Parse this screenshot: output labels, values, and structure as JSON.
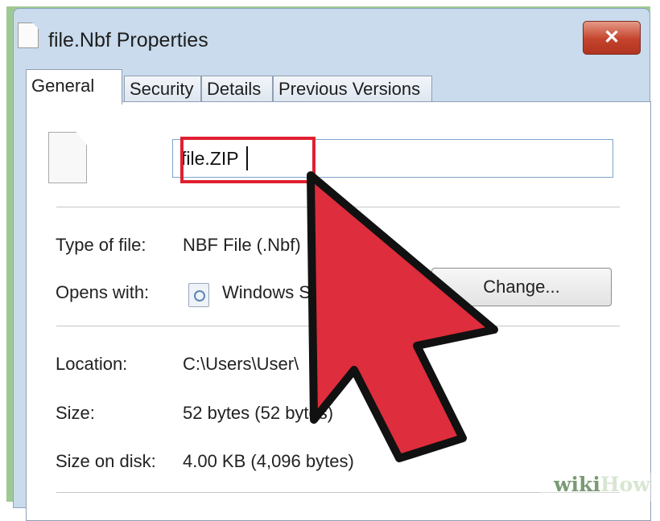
{
  "window": {
    "title": "file.Nbf Properties",
    "close_glyph": "✕"
  },
  "tabs": [
    {
      "label": "General",
      "active": true
    },
    {
      "label": "Security",
      "active": false
    },
    {
      "label": "Details",
      "active": false
    },
    {
      "label": "Previous Versions",
      "active": false
    }
  ],
  "general": {
    "filename_value": "file.ZIP",
    "type_label": "Type of file:",
    "type_value": "NBF File (.Nbf)",
    "opens_label": "Opens with:",
    "opens_value": "Windows S",
    "change_label": "Change...",
    "location_label": "Location:",
    "location_value": "C:\\Users\\User\\",
    "size_label": "Size:",
    "size_value": "52 bytes (52 bytes)",
    "size_on_disk_label": "Size on disk:",
    "size_on_disk_value": "4.00 KB (4,096 bytes)"
  },
  "watermark": {
    "text_a": "wiki",
    "text_b": "How"
  },
  "colors": {
    "highlight": "#e02030",
    "cursor_fill": "#de2d3c",
    "frame_green": "#9fc993",
    "window_chrome": "#c9dbec"
  },
  "icons": {
    "title": "document-icon",
    "file": "blank-file-icon",
    "app": "application-icon",
    "cursor": "arrow-cursor-icon"
  }
}
